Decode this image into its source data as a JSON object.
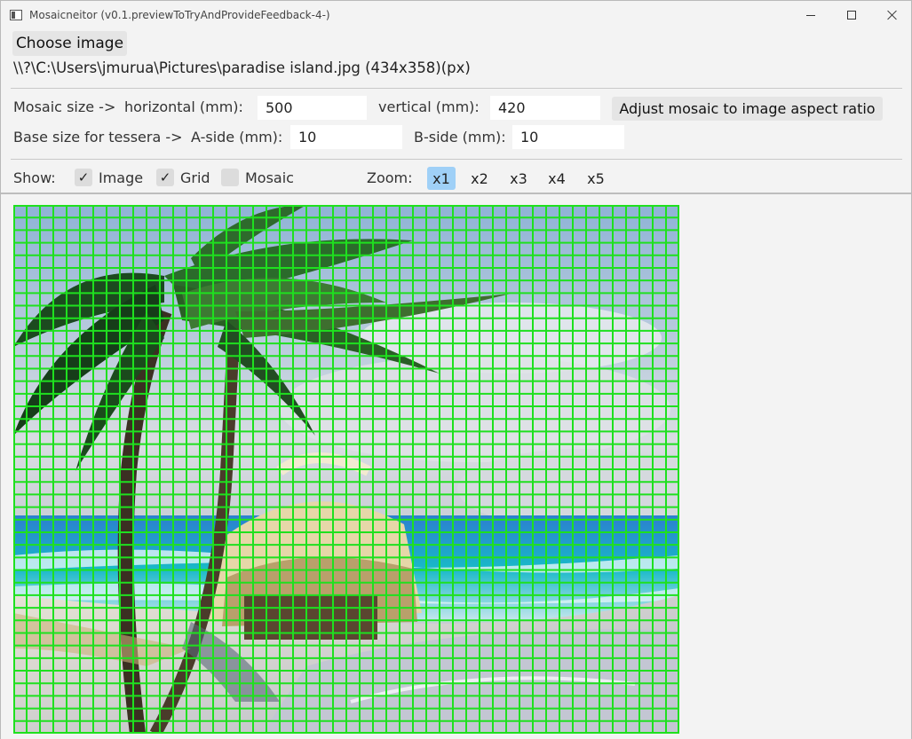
{
  "window": {
    "title": "Mosaicneitor (v0.1.previewToTryAndProvideFeedback-4-)"
  },
  "toolbar": {
    "choose_label": "Choose image",
    "file_path": "\\\\?\\C:\\Users\\jmurua\\Pictures\\paradise island.jpg (434x358)(px)"
  },
  "mosaic": {
    "size_label": "Mosaic size ->",
    "horizontal_label": "horizontal (mm):",
    "horizontal_value": "500",
    "vertical_label": "vertical (mm):",
    "vertical_value": "420",
    "adjust_label": "Adjust mosaic to image aspect ratio"
  },
  "tessera": {
    "base_label": "Base size for tessera ->",
    "a_label": "A-side (mm):",
    "a_value": "10",
    "b_label": "B-side (mm):",
    "b_value": "10"
  },
  "show": {
    "label": "Show:",
    "image_label": "Image",
    "image_checked": true,
    "grid_label": "Grid",
    "grid_checked": true,
    "mosaic_label": "Mosaic",
    "mosaic_checked": false
  },
  "zoom": {
    "label": "Zoom:",
    "options": [
      "x1",
      "x2",
      "x3",
      "x4",
      "x5"
    ],
    "selected": "x1"
  },
  "colors": {
    "grid": "#1fe01f",
    "zoom_selected": "#9fd0f7"
  }
}
